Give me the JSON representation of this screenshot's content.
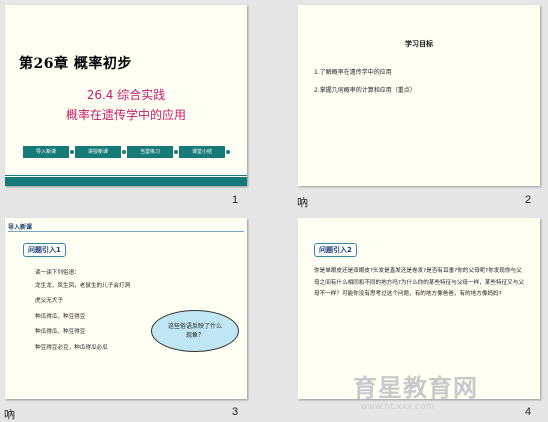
{
  "slides": [
    {
      "number": "1",
      "chapter": "第26章  概率初步",
      "subtitle1": "26.4 综合实践",
      "subtitle2": "概率在遗传学中的应用",
      "buttons": [
        "导入新课",
        "讲授新课",
        "当堂练习",
        "课堂小结"
      ]
    },
    {
      "number": "2",
      "note": "吶",
      "title": "学习目标",
      "items": [
        "1.了解概率在遗传学中的应用",
        "2.掌握几何概率的计算和应用（重点）"
      ]
    },
    {
      "number": "3",
      "note": "吶",
      "header": "导入新课",
      "label": "问题引入1",
      "lines": [
        "读一读下列俗语：",
        "龙生龙，凤生凤，老鼠生的儿子会打洞",
        "虎父无犬子",
        "种瓜得瓜，种豆得豆",
        "种瓜得瓜，种豆得豆",
        "种豆得豆必豆，种瓜得瓜必瓜"
      ],
      "cloud": "这些俗语反映了什么现象？"
    },
    {
      "number": "4",
      "label": "问题引入2",
      "text": "你是单眼皮还是双眼皮?头发是直发还是卷发?是否有耳垂?你的父母呢?你发现你与父母之间有什么相同和不同的地方吗?为什么你的某些特征与父母一样，某些特征又与父母不一样？可能你没有思考过这个问题，有的地方像爸爸，有的地方像妈妈?"
    }
  ],
  "watermark": {
    "brand": "育星教育网",
    "url": "www.ht.xxx.com"
  }
}
